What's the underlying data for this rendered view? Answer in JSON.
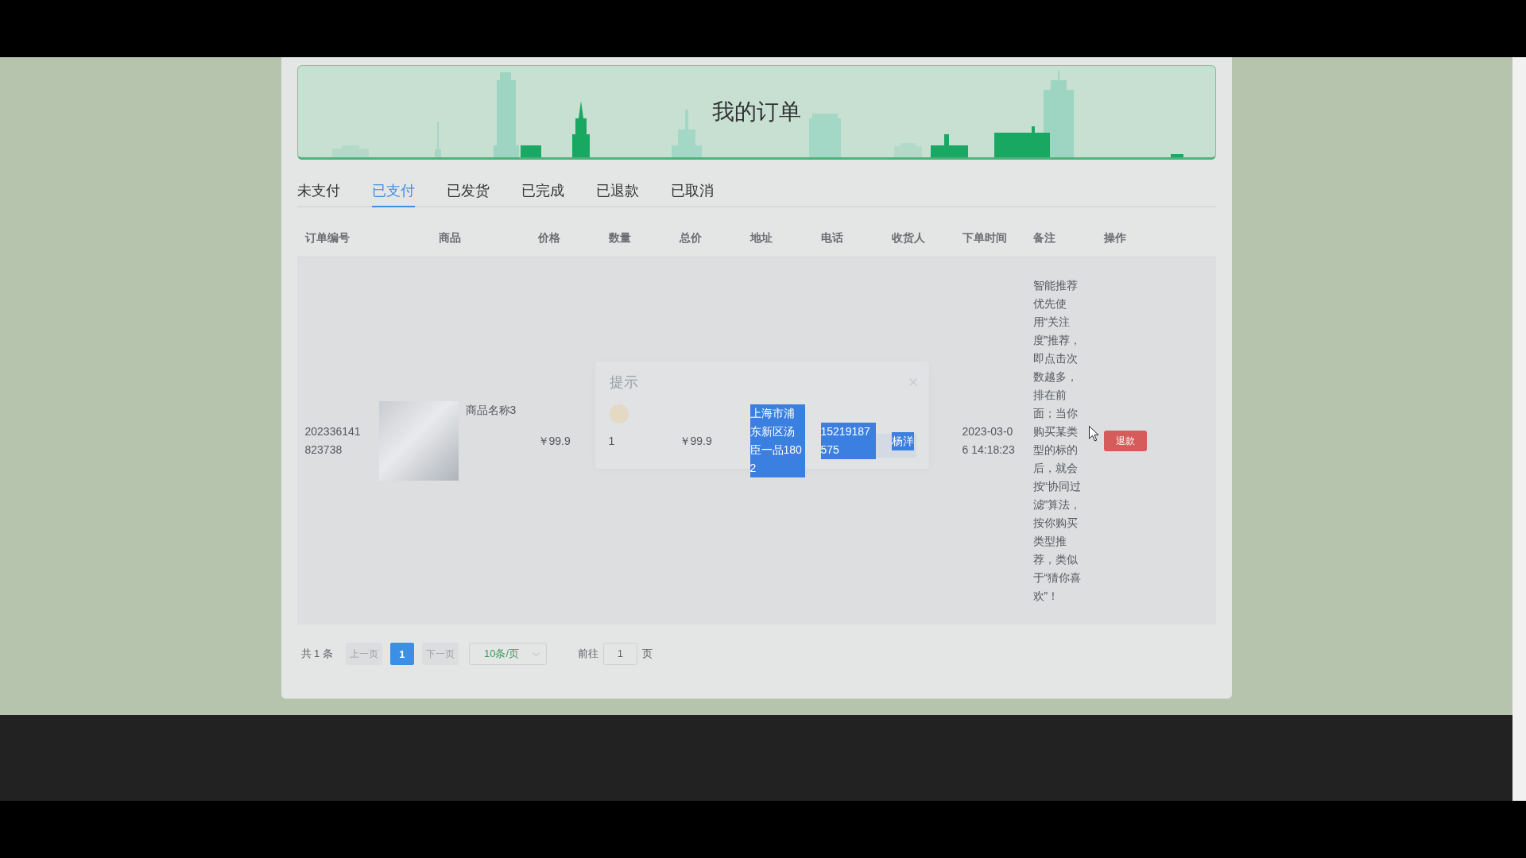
{
  "banner": {
    "title": "我的订单"
  },
  "tabs": [
    {
      "label": "未支付",
      "selected": false
    },
    {
      "label": "已支付",
      "selected": true
    },
    {
      "label": "已发货",
      "selected": false
    },
    {
      "label": "已完成",
      "selected": false
    },
    {
      "label": "已退款",
      "selected": false
    },
    {
      "label": "已取消",
      "selected": false
    }
  ],
  "table": {
    "columns": [
      "订单编号",
      "商品",
      "价格",
      "数量",
      "总价",
      "地址",
      "电话",
      "收货人",
      "下单时间",
      "备注",
      "操作"
    ],
    "rows": [
      {
        "order_number": "202336141823738",
        "product": {
          "name": "商品名称3"
        },
        "price": "￥99.9",
        "quantity": "1",
        "total": "￥99.9",
        "address": {
          "text": "上海市浦东新区汤臣一品1802",
          "highlighted": true
        },
        "phone": {
          "text": "15219187575",
          "highlighted": true
        },
        "receiver": {
          "text": "杨洋",
          "highlighted": true
        },
        "order_time": "2023-03-06 14:18:23",
        "note": "智能推荐优先使用“关注度”推荐，即点击次数越多，排在前面；当你购买某类型的标的后，就会按“协同过滤”算法，按你购买类型推荐，类似于“猜你喜欢”！",
        "actions": [
          {
            "label": "退款"
          }
        ]
      }
    ]
  },
  "pagination": {
    "total": "共 1 条",
    "prev": {
      "label": "上一页",
      "disabled": true
    },
    "pages": [
      {
        "label": "1",
        "selected": true
      }
    ],
    "next": {
      "label": "下一页",
      "disabled": true
    },
    "page_size": "10条/页",
    "jump_label": "前往",
    "jump_value": "1",
    "jump_suffix": "页"
  },
  "dialog": {
    "title": "提示"
  }
}
